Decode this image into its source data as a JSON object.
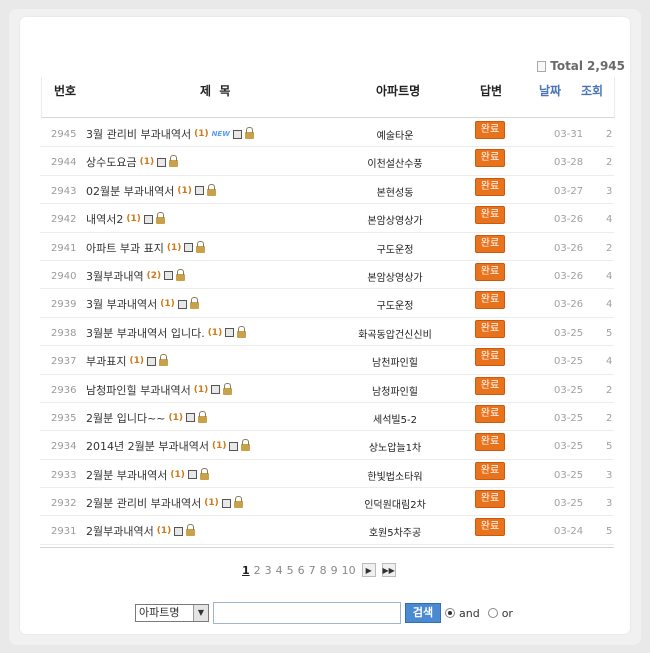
{
  "total": {
    "label": "Total",
    "value": "2,945"
  },
  "header": {
    "number": "번호",
    "title": "제  목",
    "apartment": "아파트명",
    "answer": "답변",
    "date": "날짜",
    "views": "조회"
  },
  "rows": [
    {
      "num": "2945",
      "title": "3월 관리비 부과내역서",
      "count": "(1)",
      "new": "NEW",
      "apartment": "예술타운",
      "status": "완료",
      "date": "03-31",
      "views": "2"
    },
    {
      "num": "2944",
      "title": "상수도요금",
      "count": "(1)",
      "apartment": "이천설산수풍",
      "status": "완료",
      "date": "03-28",
      "views": "2"
    },
    {
      "num": "2943",
      "title": "02월분 부과내역서",
      "count": "(1)",
      "apartment": "본현성동",
      "status": "완료",
      "date": "03-27",
      "views": "3"
    },
    {
      "num": "2942",
      "title": "내역서2",
      "count": "(1)",
      "apartment": "본암상영상가",
      "status": "완료",
      "date": "03-26",
      "views": "4"
    },
    {
      "num": "2941",
      "title": "아파트 부과 표지",
      "count": "(1)",
      "apartment": "구도운정",
      "status": "완료",
      "date": "03-26",
      "views": "2"
    },
    {
      "num": "2940",
      "title": "3월부과내역",
      "count": "(2)",
      "apartment": "본암상영상가",
      "status": "완료",
      "date": "03-26",
      "views": "4"
    },
    {
      "num": "2939",
      "title": "3월 부과내역서",
      "count": "(1)",
      "apartment": "구도운정",
      "status": "완료",
      "date": "03-26",
      "views": "4"
    },
    {
      "num": "2938",
      "title": "3월분 부과내역서 입니다.",
      "count": "(1)",
      "apartment": "화곡동압건신신비",
      "status": "완료",
      "date": "03-25",
      "views": "5"
    },
    {
      "num": "2937",
      "title": "부과표지",
      "count": "(1)",
      "apartment": "남천파인힐",
      "status": "완료",
      "date": "03-25",
      "views": "4"
    },
    {
      "num": "2936",
      "title": "남청파인힐 부과내역서",
      "count": "(1)",
      "apartment": "남청파인힐",
      "status": "완료",
      "date": "03-25",
      "views": "2"
    },
    {
      "num": "2935",
      "title": "2월분 입니다~~",
      "count": "(1)",
      "apartment": "세석빌5-2",
      "status": "완료",
      "date": "03-25",
      "views": "2"
    },
    {
      "num": "2934",
      "title": "2014년 2월분 부과내역서",
      "count": "(1)",
      "apartment": "상노압늘1차",
      "status": "완료",
      "date": "03-25",
      "views": "5"
    },
    {
      "num": "2933",
      "title": "2월분 부과내역서",
      "count": "(1)",
      "apartment": "한빛법소타워",
      "status": "완료",
      "date": "03-25",
      "views": "3"
    },
    {
      "num": "2932",
      "title": "2월분 관리비 부과내역서",
      "count": "(1)",
      "apartment": "인덕원대림2차",
      "status": "완료",
      "date": "03-25",
      "views": "3"
    },
    {
      "num": "2931",
      "title": "2월부과내역서",
      "count": "(1)",
      "apartment": "호원5차주공",
      "status": "완료",
      "date": "03-24",
      "views": "5"
    }
  ],
  "pager": {
    "pages": [
      "1",
      "2",
      "3",
      "4",
      "5",
      "6",
      "7",
      "8",
      "9",
      "10"
    ],
    "current": "1",
    "next": "▶",
    "last": "▶▶"
  },
  "search": {
    "select_value": "아파트명",
    "dropdown_arrow": "▼",
    "input_value": "",
    "button": "검색",
    "and_label": "and",
    "or_label": "or"
  }
}
